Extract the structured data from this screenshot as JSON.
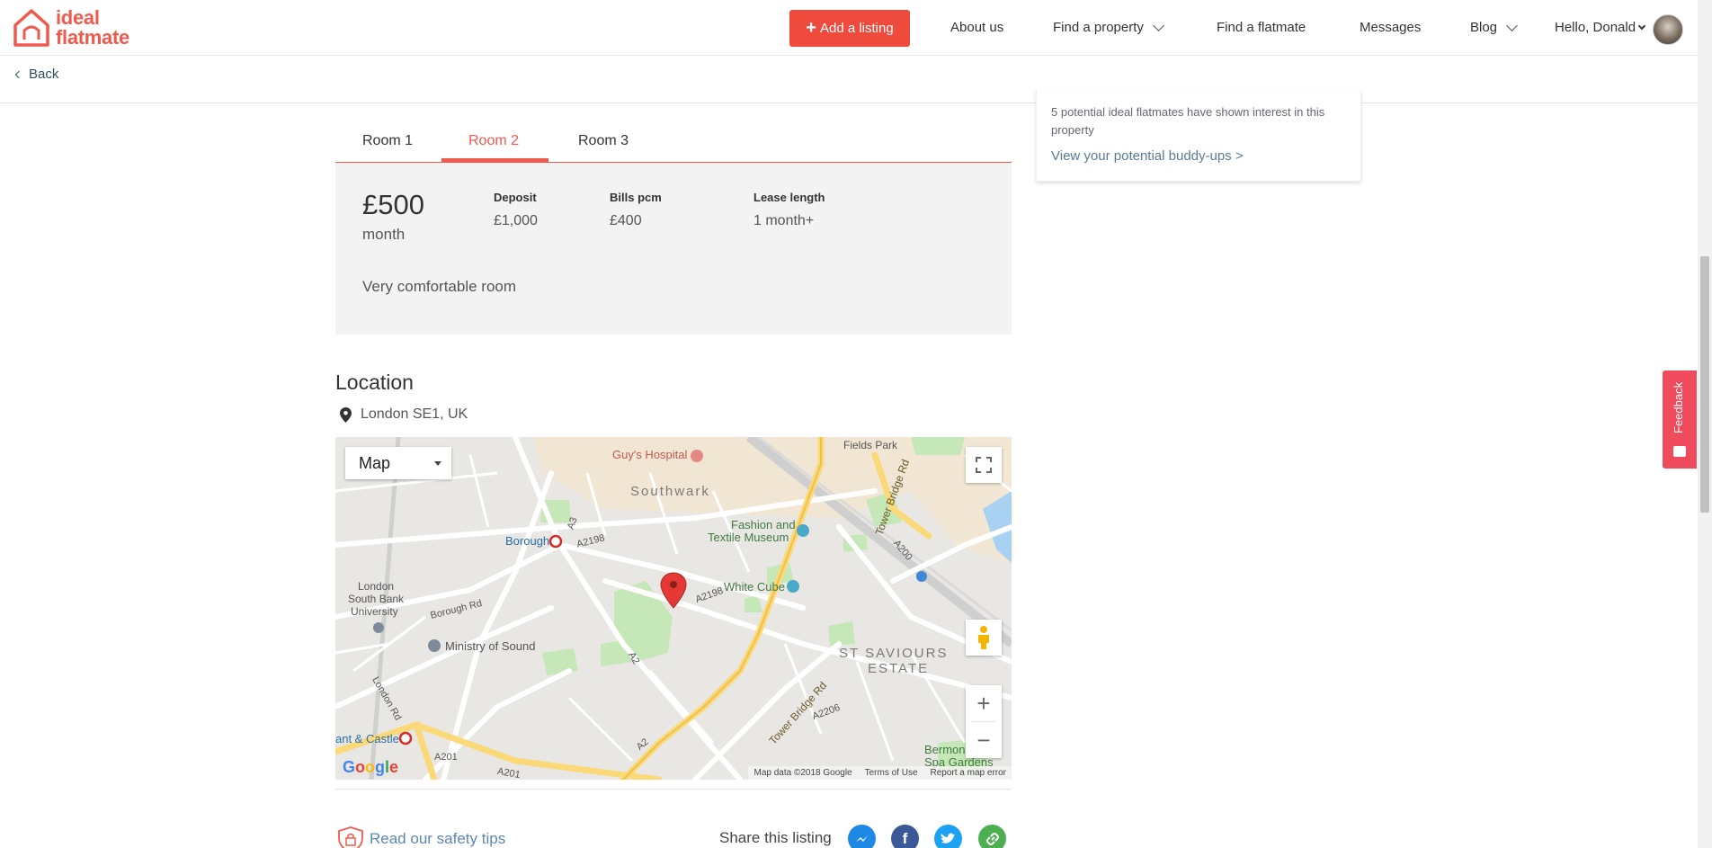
{
  "header": {
    "logo_line1": "ideal",
    "logo_line2": "flatmate",
    "add_listing_label": "Add a listing",
    "nav": {
      "about": "About us",
      "find_property": "Find a property",
      "find_flatmate": "Find a flatmate",
      "messages": "Messages",
      "blog": "Blog",
      "greeting": "Hello, Donald"
    },
    "brand_color": "#ef5a4c"
  },
  "back_label": "Back",
  "buddy_card": {
    "text": "5 potential ideal flatmates have shown interest in this property",
    "link": "View your potential buddy-ups >"
  },
  "tabs": [
    {
      "label": "Room 1",
      "active": false
    },
    {
      "label": "Room 2",
      "active": true
    },
    {
      "label": "Room 3",
      "active": false
    }
  ],
  "room": {
    "price": "£500",
    "period": "month",
    "deposit_label": "Deposit",
    "deposit_value": "£1,000",
    "bills_label": "Bills pcm",
    "bills_value": "£400",
    "lease_label": "Lease length",
    "lease_value": "1 month+",
    "description": "Very comfortable room"
  },
  "location": {
    "title": "Location",
    "address": "London SE1, UK"
  },
  "map": {
    "type_label": "Map",
    "attribution": {
      "data": "Map data ©2018 Google",
      "terms": "Terms of Use",
      "report": "Report a map error"
    },
    "google_logo": "Google",
    "labels": {
      "guys_hospital": "Guy's Hospital",
      "southwark": "Southwark",
      "borough": "Borough",
      "fashion1": "Fashion and",
      "fashion2": "Textile Museum",
      "white_cube": "White Cube",
      "lsbu1": "London",
      "lsbu2": "South Bank",
      "lsbu3": "University",
      "ministry": "Ministry of Sound",
      "st_saviours1": "ST SAVIOURS",
      "st_saviours2": "ESTATE",
      "fields_park": "Fields Park",
      "bermondsey1": "Bermon",
      "bermondsey2": "Spa Gardens",
      "elephant": "ant & Castle",
      "tower_bridge_rd": "Tower Bridge Rd",
      "borough_rd": "Borough Rd",
      "a201": "A201",
      "a2": "A2",
      "a3": "A3",
      "a2198": "A2198",
      "a2206": "A2206",
      "a200": "A200",
      "london_rd": "London Rd"
    }
  },
  "footer": {
    "safety_link": "Read our safety tips",
    "share_label": "Share this listing"
  },
  "feedback_label": "Feedback"
}
